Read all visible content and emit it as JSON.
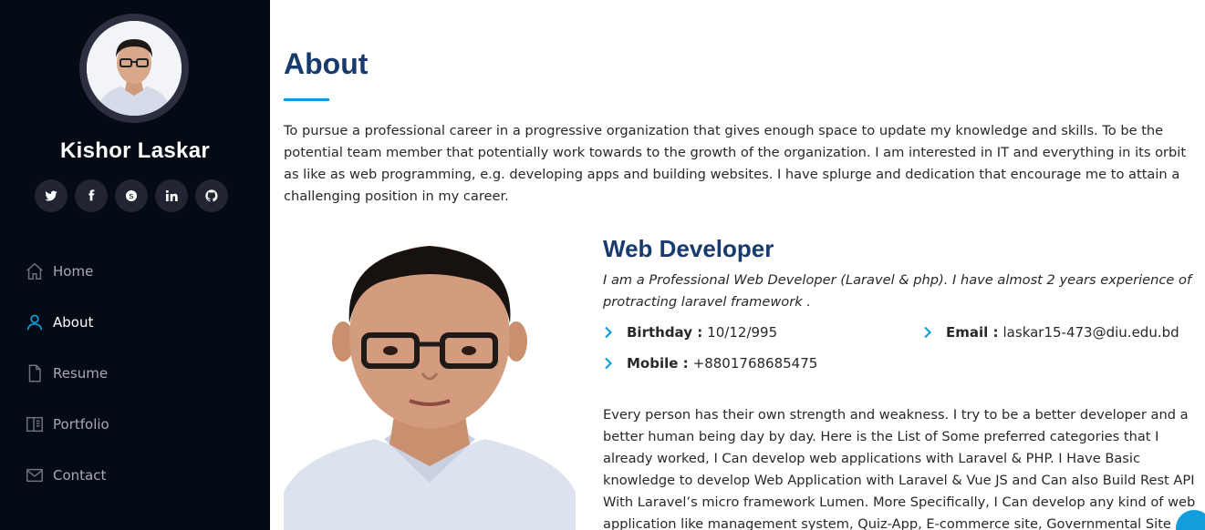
{
  "sidebar": {
    "name": "Kishor Laskar",
    "social": [
      "twitter-icon",
      "facebook-icon",
      "skype-icon",
      "linkedin-icon",
      "github-icon"
    ],
    "nav": [
      {
        "label": "Home",
        "icon": "home-icon"
      },
      {
        "label": "About",
        "icon": "user-icon",
        "active": true
      },
      {
        "label": "Resume",
        "icon": "file-icon"
      },
      {
        "label": "Portfolio",
        "icon": "book-icon"
      },
      {
        "label": "Contact",
        "icon": "envelope-icon"
      }
    ]
  },
  "about": {
    "title": "About",
    "intro": "To pursue a professional career in a progressive organization that gives enough space to update my knowledge and skills. To be the potential team member that potentially work towards to the growth of the organization. I am interested in IT and everything in its orbit as like as web programming, e.g. developing apps and building websites. I have splurge and dedication that encourage me to attain a challenging position in my career.",
    "role_title": "Web Developer",
    "role_desc": "I am a Professional Web Developer (Laravel & php). I have almost 2 years experience of protracting laravel framework .",
    "birthday_label": "Birthday :",
    "birthday_value": "10/12/995",
    "email_label": "Email :",
    "email_value": "laskar15-473@diu.edu.bd",
    "mobile_label": "Mobile :",
    "mobile_value": "+8801768685475",
    "body": "Every person has their own strength and weakness. I try to be a better developer and a better human being day by day. Here is the List of Some preferred categories that I already worked, I Can develop web applications with Laravel & PHP. I Have Basic knowledge to develop Web Application with Laravel & Vue JS and Can also Build Rest API With Laravel’s micro framework Lumen. More Specifically, I Can develop any kind of web application like management system, Quiz-App, E-commerce site, Governmental Site"
  },
  "colors": {
    "sidebar_bg": "#040b14",
    "accent": "#149ddd",
    "heading": "#173b6c"
  }
}
